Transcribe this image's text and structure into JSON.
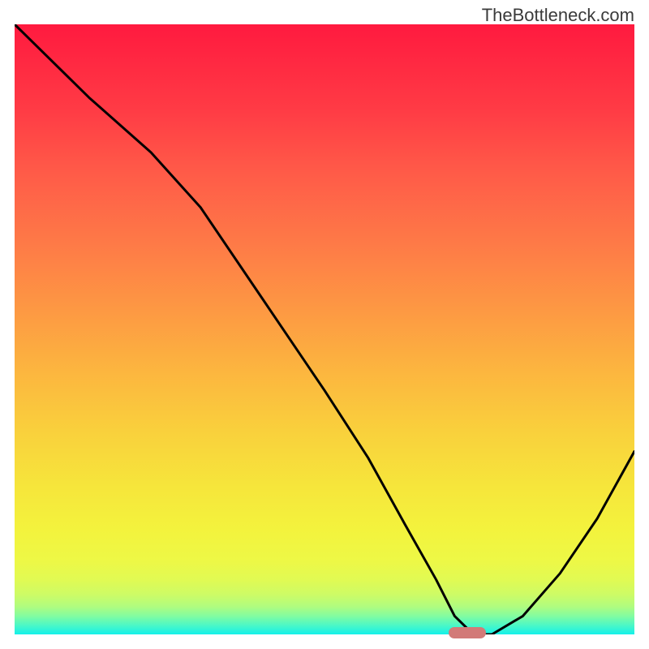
{
  "watermark": "TheBottleneck.com",
  "chart_data": {
    "type": "line",
    "title": "",
    "xlabel": "",
    "ylabel": "",
    "xlim": [
      0,
      100
    ],
    "ylim": [
      0,
      100
    ],
    "series": [
      {
        "name": "bottleneck-curve",
        "x": [
          0,
          12,
          22,
          30,
          40,
          50,
          57,
          63,
          68,
          71,
          74,
          77,
          82,
          88,
          94,
          100
        ],
        "values": [
          100,
          88,
          79,
          70,
          55,
          40,
          29,
          18,
          9,
          3,
          0,
          0,
          3,
          10,
          19,
          30
        ]
      }
    ],
    "valley_marker": {
      "x_start": 70,
      "x_end": 76,
      "y": 0
    },
    "colors": {
      "curve": "#000000",
      "marker": "#d27a78",
      "gradient_top": "#ff1a3f",
      "gradient_bottom": "#14f0ea"
    }
  }
}
